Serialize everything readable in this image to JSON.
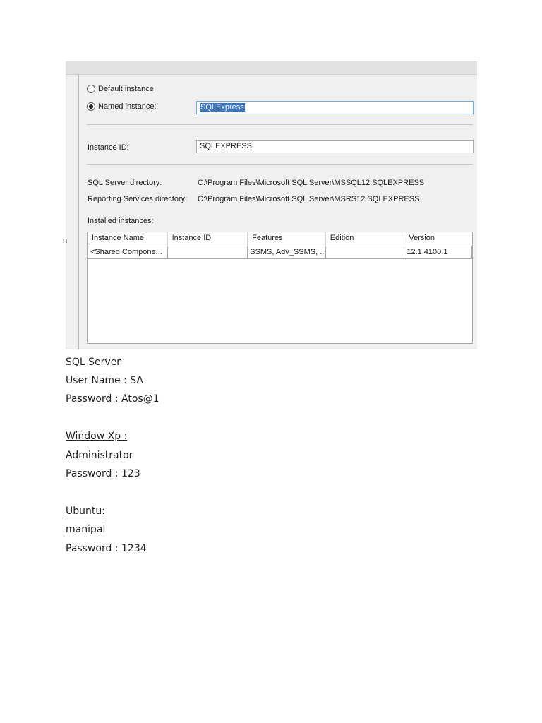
{
  "dialog": {
    "default_instance_label": "Default instance",
    "named_instance_label": "Named instance:",
    "named_instance_value": "SQLExpress",
    "instance_id_label": "Instance ID:",
    "instance_id_value": "SQLEXPRESS",
    "sql_dir_label": "SQL Server directory:",
    "sql_dir_value": "C:\\Program Files\\Microsoft SQL Server\\MSSQL12.SQLEXPRESS",
    "rs_dir_label": "Reporting Services directory:",
    "rs_dir_value": "C:\\Program Files\\Microsoft SQL Server\\MSRS12.SQLEXPRESS",
    "installed_label": "Installed instances:",
    "left_fragment": "n",
    "table": {
      "headers": [
        "Instance Name",
        "Instance ID",
        "Features",
        "Edition",
        "Version"
      ],
      "rows": [
        [
          "<Shared Compone...",
          "",
          "SSMS, Adv_SSMS, ...",
          "",
          "12.1.4100.1"
        ]
      ]
    }
  },
  "notes": [
    {
      "heading": "SQL Server",
      "lines": [
        "User Name : SA",
        "Password : Atos@1"
      ]
    },
    {
      "heading": "Window Xp :",
      "lines": [
        "Administrator",
        "Password : 123"
      ]
    },
    {
      "heading": "Ubuntu:",
      "lines": [
        "manipal",
        "Password : 1234"
      ]
    }
  ]
}
